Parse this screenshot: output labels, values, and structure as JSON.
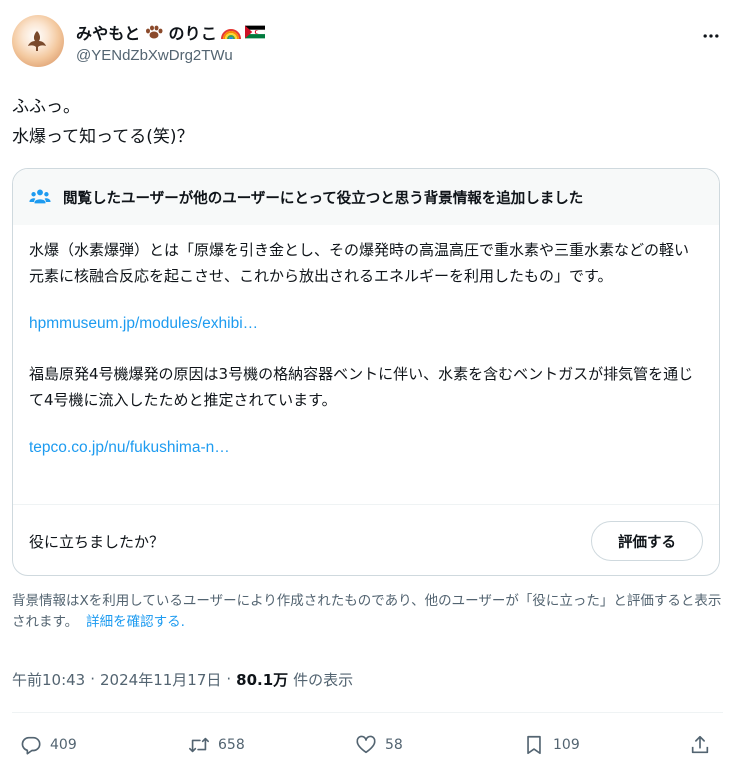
{
  "author": {
    "display_name": "みやもと🐾のりこ🏳️‍🌈🇪🇭",
    "display_name_text": "みやもと",
    "display_name_text2": "のりこ",
    "handle": "@YENdZbXwDrg2TWu"
  },
  "tweet": {
    "lines": [
      "ふふっ。",
      "水爆って知ってる(笑)？"
    ]
  },
  "community_note": {
    "header": "閲覧したユーザーが他のユーザーにとって役立つと思う背景情報を追加しました",
    "paragraph1": "水爆（水素爆弾）とは「原爆を引き金とし、その爆発時の高温高圧で重水素や三重水素などの軽い元素に核融合反応を起こさせ、これから放出されるエネルギーを利用したもの」です。",
    "link1": "hpmmuseum.jp/modules/exhibi…",
    "paragraph2": "福島原発4号機爆発の原因は3号機の格納容器ベントに伴い、水素を含むベントガスが排気管を通じて4号機に流入したためと推定されています。",
    "link2": "tepco.co.jp/nu/fukushima-n…",
    "helpful_question": "役に立ちましたか？",
    "rate_button": "評価する"
  },
  "disclaimer": {
    "text": "背景情報はXを利用しているユーザーにより作成されたものであり、他のユーザーが「役に立った」と評価すると表示されます。",
    "link": "詳細を確認する."
  },
  "meta": {
    "time": "午前10:43",
    "separator": "·",
    "date": "2024年11月17日",
    "views_count": "80.1万",
    "views_label": "件の表示"
  },
  "actions": {
    "replies": "409",
    "reposts": "658",
    "likes": "58",
    "bookmarks": "109"
  },
  "icons": {
    "more": "more-horizontal-icon",
    "community": "community-notes-icon",
    "reply": "reply-icon",
    "repost": "repost-icon",
    "like": "heart-icon",
    "bookmark": "bookmark-icon",
    "share": "share-icon"
  },
  "colors": {
    "link": "#1d9bf0",
    "text": "#0f1419",
    "secondary": "#536471",
    "border": "#cfd9de"
  }
}
